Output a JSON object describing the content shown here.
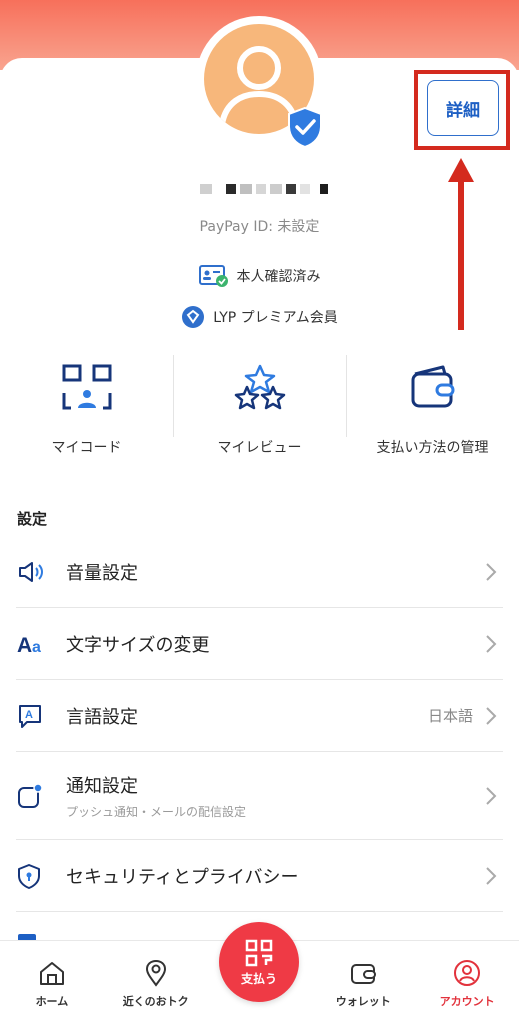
{
  "profile": {
    "paypay_id": "PayPay ID: 未設定",
    "detail_label": "詳細",
    "identity_label": "本人確認済み",
    "premium_label": "LYP プレミアム会員"
  },
  "shortcuts": [
    {
      "label": "マイコード",
      "icon": "qr-person-icon"
    },
    {
      "label": "マイレビュー",
      "icon": "stars-icon"
    },
    {
      "label": "支払い方法の管理",
      "icon": "wallet-icon"
    }
  ],
  "settings": {
    "title": "設定",
    "items": [
      {
        "label": "音量設定",
        "icon": "speaker-icon",
        "value": "",
        "sub": ""
      },
      {
        "label": "文字サイズの変更",
        "icon": "text-size-icon",
        "value": "",
        "sub": ""
      },
      {
        "label": "言語設定",
        "icon": "language-icon",
        "value": "日本語",
        "sub": ""
      },
      {
        "label": "通知設定",
        "icon": "notification-icon",
        "value": "",
        "sub": "プッシュ通知・メールの配信設定"
      },
      {
        "label": "セキュリティとプライバシー",
        "icon": "security-shield-icon",
        "value": "",
        "sub": ""
      }
    ]
  },
  "nav": {
    "items": [
      {
        "label": "ホーム",
        "icon": "home-icon"
      },
      {
        "label": "近くのおトク",
        "icon": "location-pin-icon"
      },
      {
        "label": "支払う",
        "icon": "pay-qr-icon"
      },
      {
        "label": "ウォレット",
        "icon": "wallet-icon"
      },
      {
        "label": "アカウント",
        "icon": "account-icon"
      }
    ]
  },
  "colors": {
    "accent_blue": "#1d5fc4",
    "brand_red": "#ef3a45",
    "highlight_red": "#d42a1e",
    "avatar_orange": "#f7b77b"
  }
}
